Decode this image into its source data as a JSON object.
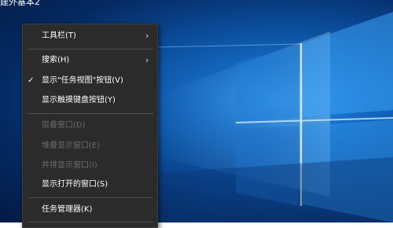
{
  "window_title": "建外基本2",
  "menu": {
    "items": [
      {
        "label": "工具栏(T)",
        "submenu": true
      },
      {
        "label": "搜索(H)",
        "submenu": true
      },
      {
        "label": "显示\"任务视图\"按钮(V)",
        "checked": true
      },
      {
        "label": "显示触摸键盘按钮(Y)"
      },
      {
        "label": "层叠窗口(D)",
        "disabled": true
      },
      {
        "label": "堆叠显示窗口(E)",
        "disabled": true
      },
      {
        "label": "并排显示窗口(I)",
        "disabled": true
      },
      {
        "label": "显示打开的窗口(S)"
      },
      {
        "label": "任务管理器(K)"
      }
    ]
  },
  "icons": {
    "submenu_arrow": "chevron-right-icon",
    "checked": "checkmark-icon"
  },
  "colors": {
    "menu_background": "#2b2b2b",
    "desktop_accent": "#1468c0",
    "disabled_text": "#6d6d6d"
  }
}
